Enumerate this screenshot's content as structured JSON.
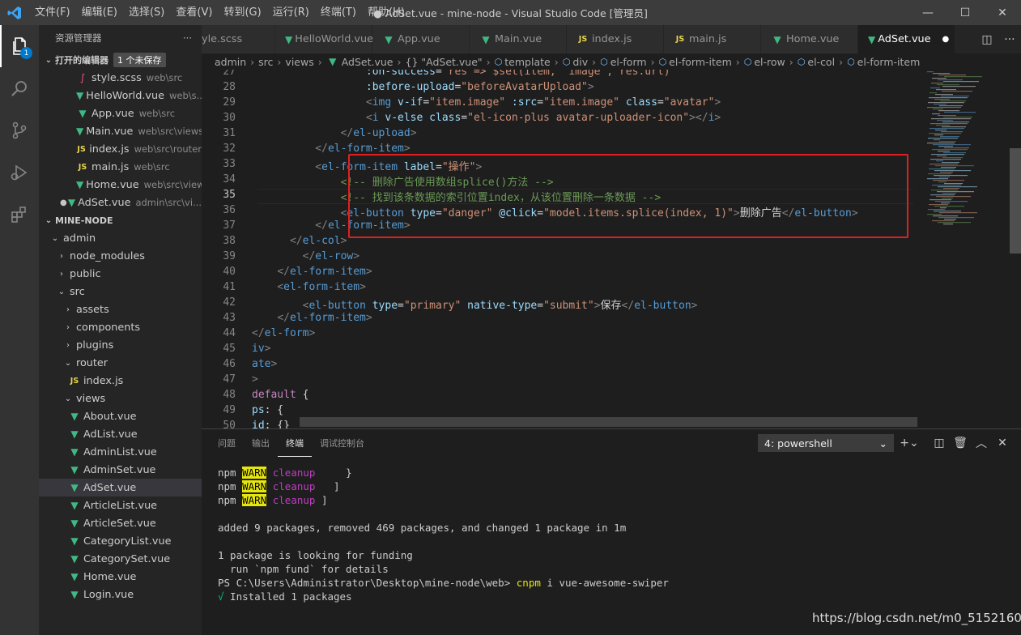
{
  "window": {
    "title": "● AdSet.vue - mine-node - Visual Studio Code [管理员]",
    "menu": [
      "文件(F)",
      "编辑(E)",
      "选择(S)",
      "查看(V)",
      "转到(G)",
      "运行(R)",
      "终端(T)",
      "帮助(H)"
    ]
  },
  "activity": {
    "explorer_badge": "1"
  },
  "sidebar": {
    "title": "资源管理器",
    "more": "···",
    "open_editors": {
      "label": "打开的编辑器",
      "unsaved": "1 个未保存",
      "items": [
        {
          "name": "style.scss",
          "desc": "web\\src",
          "kind": "scss"
        },
        {
          "name": "HelloWorld.vue",
          "desc": "web\\s...",
          "kind": "vue"
        },
        {
          "name": "App.vue",
          "desc": "web\\src",
          "kind": "vue"
        },
        {
          "name": "Main.vue",
          "desc": "web\\src\\views",
          "kind": "vue"
        },
        {
          "name": "index.js",
          "desc": "web\\src\\router",
          "kind": "js"
        },
        {
          "name": "main.js",
          "desc": "web\\src",
          "kind": "js"
        },
        {
          "name": "Home.vue",
          "desc": "web\\src\\views",
          "kind": "vue"
        },
        {
          "name": "AdSet.vue",
          "desc": "admin\\src\\vi...",
          "kind": "vue"
        }
      ]
    },
    "project": {
      "label": "MINE-NODE",
      "tree": [
        {
          "name": "admin",
          "indent": 1,
          "chev": "⌄"
        },
        {
          "name": "node_modules",
          "indent": 2,
          "chev": "›"
        },
        {
          "name": "public",
          "indent": 2,
          "chev": "›"
        },
        {
          "name": "src",
          "indent": 2,
          "chev": "⌄"
        },
        {
          "name": "assets",
          "indent": 3,
          "chev": "›"
        },
        {
          "name": "components",
          "indent": 3,
          "chev": "›"
        },
        {
          "name": "plugins",
          "indent": 3,
          "chev": "›"
        },
        {
          "name": "router",
          "indent": 3,
          "chev": "⌄"
        },
        {
          "name": "index.js",
          "indent": 4,
          "kind": "js"
        },
        {
          "name": "views",
          "indent": 3,
          "chev": "⌄"
        },
        {
          "name": "About.vue",
          "indent": 4,
          "kind": "vue"
        },
        {
          "name": "AdList.vue",
          "indent": 4,
          "kind": "vue"
        },
        {
          "name": "AdminList.vue",
          "indent": 4,
          "kind": "vue"
        },
        {
          "name": "AdminSet.vue",
          "indent": 4,
          "kind": "vue"
        },
        {
          "name": "AdSet.vue",
          "indent": 4,
          "kind": "vue",
          "selected": true
        },
        {
          "name": "ArticleList.vue",
          "indent": 4,
          "kind": "vue"
        },
        {
          "name": "ArticleSet.vue",
          "indent": 4,
          "kind": "vue"
        },
        {
          "name": "CategoryList.vue",
          "indent": 4,
          "kind": "vue"
        },
        {
          "name": "CategorySet.vue",
          "indent": 4,
          "kind": "vue"
        },
        {
          "name": "Home.vue",
          "indent": 4,
          "kind": "vue"
        },
        {
          "name": "Login.vue",
          "indent": 4,
          "kind": "vue"
        }
      ]
    }
  },
  "tabs": [
    {
      "name": "yle.scss",
      "kind": "scss"
    },
    {
      "name": "HelloWorld.vue",
      "kind": "vue"
    },
    {
      "name": "App.vue",
      "kind": "vue"
    },
    {
      "name": "Main.vue",
      "kind": "vue"
    },
    {
      "name": "index.js",
      "kind": "js"
    },
    {
      "name": "main.js",
      "kind": "js"
    },
    {
      "name": "Home.vue",
      "kind": "vue"
    },
    {
      "name": "AdSet.vue",
      "kind": "vue",
      "active": true,
      "dirty": "●"
    }
  ],
  "breadcrumb": [
    "admin",
    "src",
    "views",
    "AdSet.vue",
    "{} \"AdSet.vue\"",
    "template",
    "div",
    "el-form",
    "el-form-item",
    "el-row",
    "el-col",
    "el-form-item"
  ],
  "editor": {
    "current_line": "35",
    "lines": [
      {
        "n": "27",
        "html": "                  <span class='at'>:on-success</span><span class='tx'>=</span><span class='st'>\"res => $set(item, 'image', res.url)\"</span>"
      },
      {
        "n": "28",
        "html": "                  <span class='at'>:before-upload</span><span class='tx'>=</span><span class='st'>\"beforeAvatarUpload\"</span><span class='pc'>></span>"
      },
      {
        "n": "29",
        "html": "                  <span class='pc'>&lt;</span><span class='tg'>img</span> <span class='at'>v-if</span>=<span class='st'>\"item.image\"</span> <span class='at'>:src</span>=<span class='st'>\"item.image\"</span> <span class='at'>class</span>=<span class='st'>\"avatar\"</span><span class='pc'>></span>"
      },
      {
        "n": "30",
        "html": "                  <span class='pc'>&lt;</span><span class='tg'>i</span> <span class='at'>v-else</span> <span class='at'>class</span>=<span class='st'>\"el-icon-plus avatar-uploader-icon\"</span><span class='pc'>>&lt;/</span><span class='tg'>i</span><span class='pc'>></span>"
      },
      {
        "n": "31",
        "html": "              <span class='pc'>&lt;/</span><span class='tg'>el-upload</span><span class='pc'>></span>"
      },
      {
        "n": "32",
        "html": "          <span class='pc'>&lt;/</span><span class='tg'>el-form-item</span><span class='pc'>></span>"
      },
      {
        "n": "33",
        "html": "          <span class='pc'>&lt;</span><span class='tg'>el-form-item</span> <span class='at'>label</span>=<span class='st'>\"操作\"</span><span class='pc'>></span>"
      },
      {
        "n": "34",
        "html": "              <span class='cm'>&lt;!-- 删除广告使用数组splice()方法 --></span>"
      },
      {
        "n": "35",
        "html": "              <span class='cm'>&lt;!-- 找到该条数据的索引位置index，从该位置删除一条数据 --></span>"
      },
      {
        "n": "36",
        "html": "              <span class='pc'>&lt;</span><span class='tg'>el-button</span> <span class='at'>type</span>=<span class='st'>\"danger\"</span> <span class='at'>@click</span>=<span class='st'>\"model.items.splice(index, 1)\"</span><span class='pc'>></span><span class='tx'>删除广告</span><span class='pc'>&lt;/</span><span class='tg'>el-button</span><span class='pc'>></span>"
      },
      {
        "n": "37",
        "html": "          <span class='pc'>&lt;/</span><span class='tg'>el-form-item</span><span class='pc'>></span>"
      },
      {
        "n": "38",
        "html": "      <span class='pc'>&lt;/</span><span class='tg'>el-col</span><span class='pc'>></span>"
      },
      {
        "n": "39",
        "html": "        <span class='pc'>&lt;/</span><span class='tg'>el-row</span><span class='pc'>></span>"
      },
      {
        "n": "40",
        "html": "    <span class='pc'>&lt;/</span><span class='tg'>el-form-item</span><span class='pc'>></span>"
      },
      {
        "n": "41",
        "html": "    <span class='pc'>&lt;</span><span class='tg'>el-form-item</span><span class='pc'>></span>"
      },
      {
        "n": "42",
        "html": "        <span class='pc'>&lt;</span><span class='tg'>el-button</span> <span class='at'>type</span>=<span class='st'>\"primary\"</span> <span class='at'>native-type</span>=<span class='st'>\"submit\"</span><span class='pc'>></span><span class='tx'>保存</span><span class='pc'>&lt;/</span><span class='tg'>el-button</span><span class='pc'>></span>"
      },
      {
        "n": "43",
        "html": "    <span class='pc'>&lt;/</span><span class='tg'>el-form-item</span><span class='pc'>></span>"
      },
      {
        "n": "44",
        "html": "<span class='pc'>&lt;/</span><span class='tg'>el-form</span><span class='pc'>></span>"
      },
      {
        "n": "45",
        "html": "<span class='tg'>iv</span><span class='pc'>></span>"
      },
      {
        "n": "46",
        "html": "<span class='tg'>ate</span><span class='pc'>></span>"
      },
      {
        "n": "47",
        "html": "<span class='pc'>></span>"
      },
      {
        "n": "48",
        "html": "<span class='kw'>default</span> <span class='tx'>{</span>"
      },
      {
        "n": "49",
        "html": "<span class='at'>ps</span><span class='tx'>: {</span>"
      },
      {
        "n": "50",
        "html": "<span class='at'>id</span><span class='tx'>: {}</span>"
      }
    ]
  },
  "panel": {
    "tabs": [
      "问题",
      "输出",
      "终端",
      "调试控制台"
    ],
    "active_tab": "终端",
    "terminal_select": "4: powershell",
    "lines": [
      {
        "html": "npm <span class='warn'>WARN</span> <span class='mag'>cleanup</span>     }"
      },
      {
        "html": "npm <span class='warn'>WARN</span> <span class='mag'>cleanup</span>   ]"
      },
      {
        "html": "npm <span class='warn'>WARN</span> <span class='mag'>cleanup</span> ]"
      },
      {
        "html": ""
      },
      {
        "html": "added 9 packages, removed 469 packages, and changed 1 package in 1m"
      },
      {
        "html": ""
      },
      {
        "html": "1 package is looking for funding"
      },
      {
        "html": "  run `npm fund` for details"
      },
      {
        "html": "PS C:\\Users\\Administrator\\Desktop\\mine-node\\web> <span class='ylw'>cnpm</span> i vue-awesome-swiper"
      },
      {
        "html": "<span class='grn'>√</span> Installed 1 packages"
      }
    ]
  },
  "watermark": "https://blog.csdn.net/m0_51521604"
}
